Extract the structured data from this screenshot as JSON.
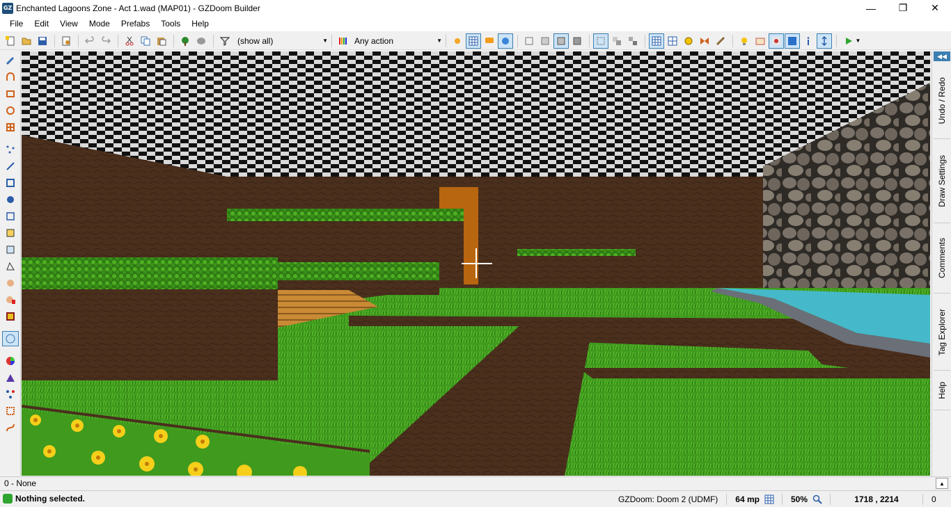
{
  "window": {
    "title": "Enchanted Lagoons Zone - Act 1.wad (MAP01) - GZDoom Builder",
    "app_badge": "GZ",
    "minimize_glyph": "—",
    "maximize_glyph": "❐",
    "close_glyph": "✕"
  },
  "menu": [
    "File",
    "Edit",
    "View",
    "Mode",
    "Prefabs",
    "Tools",
    "Help"
  ],
  "toolbar": {
    "filter_value": "(show all)",
    "action_value": "Any action"
  },
  "right_dock": {
    "collapse_glyph": "◀◀",
    "tabs": [
      "Undo / Redo",
      "Draw Settings",
      "Comments",
      "Tag Explorer",
      "Help"
    ]
  },
  "info_bar": {
    "text": "0 - None",
    "expand_glyph": "▲"
  },
  "status": {
    "message": "Nothing selected.",
    "engine": "GZDoom: Doom 2 (UDMF)",
    "grid": "64 mp",
    "zoom": "50%",
    "coordinates": "1718 , 2214",
    "extra": "0"
  },
  "colors": {
    "grass": "#3f9a1e",
    "dirt": "#4a2f1d",
    "water": "#45b9c9",
    "ceiling_dark": "#111111",
    "ceiling_light": "#d9d9d9",
    "stone": "#6b6b63",
    "accent": "#3c7fb1"
  }
}
